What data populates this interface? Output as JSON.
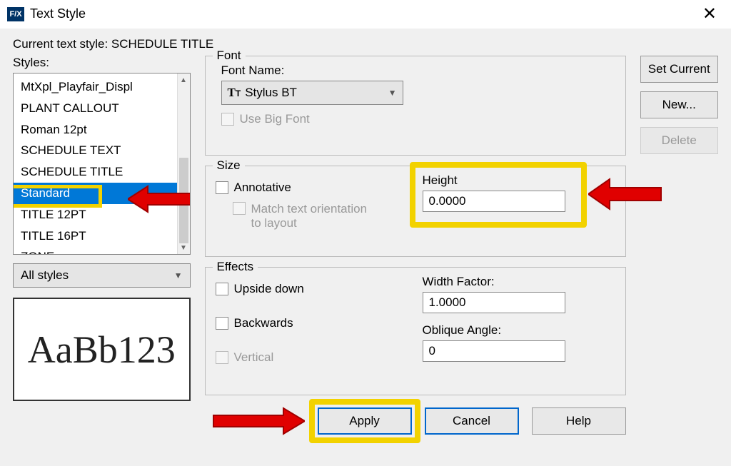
{
  "titlebar": {
    "icon_text": "F/X",
    "title": "Text Style"
  },
  "current_style_line": "Current text style: SCHEDULE TITLE",
  "styles_label": "Styles:",
  "styles_list": [
    "MtXpl_Playfair_Displ",
    "PLANT CALLOUT",
    "Roman 12pt",
    "SCHEDULE TEXT",
    "SCHEDULE TITLE",
    "Standard",
    "TITLE 12PT",
    "TITLE 16PT",
    "ZONE"
  ],
  "selected_style_index": 5,
  "filter_dropdown": "All styles",
  "preview_text": "AaBb123",
  "font_group": {
    "title": "Font",
    "name_label": "Font Name:",
    "name_value": "Stylus BT",
    "bigfont_label": "Use Big Font"
  },
  "size_group": {
    "title": "Size",
    "annotative_label": "Annotative",
    "match_label": "Match text orientation to layout",
    "height_label": "Height",
    "height_value": "0.0000"
  },
  "effects_group": {
    "title": "Effects",
    "upside_label": "Upside down",
    "backwards_label": "Backwards",
    "vertical_label": "Vertical",
    "width_label": "Width Factor:",
    "width_value": "1.0000",
    "oblique_label": "Oblique Angle:",
    "oblique_value": "0"
  },
  "side_buttons": {
    "set_current": "Set Current",
    "new": "New...",
    "delete": "Delete"
  },
  "bottom_buttons": {
    "apply": "Apply",
    "cancel": "Cancel",
    "help": "Help"
  }
}
